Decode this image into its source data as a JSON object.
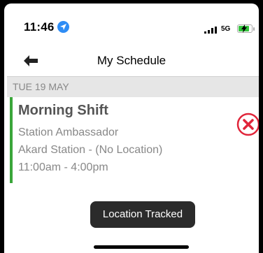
{
  "status_bar": {
    "time": "11:46",
    "network": "5G",
    "location_icon": "location-arrow-icon",
    "battery_level": 0.75,
    "battery_color": "#36c33f"
  },
  "nav": {
    "title": "My Schedule",
    "back_icon": "arrow-left-icon"
  },
  "schedule": {
    "date_header": "TUE 19 MAY",
    "shifts": [
      {
        "title": "Morning Shift",
        "role": "Station Ambassador",
        "location": "Akard Station - (No Location)",
        "time_range": "11:00am - 4:00pm",
        "accent_color": "#3aa63a",
        "action_icon": "cancel-circle-icon"
      }
    ]
  },
  "toast": {
    "message": "Location Tracked"
  }
}
